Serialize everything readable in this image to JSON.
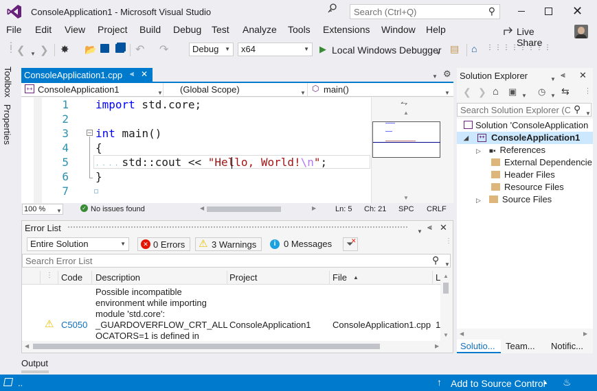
{
  "titlebar": {
    "title": "ConsoleApplication1 - Microsoft Visual Studio",
    "search_placeholder": "Search (Ctrl+Q)"
  },
  "menu": [
    "File",
    "Edit",
    "View",
    "Project",
    "Build",
    "Debug",
    "Test",
    "Analyze",
    "Tools",
    "Extensions",
    "Window",
    "Help"
  ],
  "live_share": "Live Share",
  "toolbar": {
    "config": "Debug",
    "platform": "x64",
    "run_label": "Local Windows Debugger"
  },
  "side_tabs": [
    "Toolbox",
    "Properties"
  ],
  "editor": {
    "tab_label": "ConsoleApplication1.cpp",
    "nav_project": "ConsoleApplication1",
    "nav_scope": "(Global Scope)",
    "nav_member": "main()",
    "line_numbers": [
      "1",
      "2",
      "3",
      "4",
      "5",
      "6",
      "7"
    ],
    "code": {
      "l1_kw": "import",
      "l1_rest": " std.core;",
      "l3_kw": "int",
      "l3_rest": " main()",
      "l4": "{",
      "l5_pre": "    std::cout << ",
      "l5_str": "\"Hello, World!",
      "l5_esc": "\\n",
      "l5_end_str": "\"",
      "l5_end": ";",
      "l6": "}"
    },
    "status": {
      "zoom": "100 %",
      "issues": "No issues found",
      "ln": "Ln: 5",
      "ch": "Ch: 21",
      "spc": "SPC",
      "crlf": "CRLF"
    }
  },
  "error_list": {
    "title": "Error List",
    "scope": "Entire Solution",
    "errors": "0 Errors",
    "warnings": "3 Warnings",
    "messages": "0 Messages",
    "search_placeholder": "Search Error List",
    "columns": [
      "Code",
      "Description",
      "Project",
      "File",
      "L"
    ],
    "rows": [
      {
        "code": "C5050",
        "description": "Possible incompatible environment while importing module 'std.core': _GUARDOVERFLOW_CRT_ALLOCATORS=1 is defined in",
        "desc_lines": [
          "Possible incompatible",
          "environment while importing",
          "module 'std.core':",
          "_GUARDOVERFLOW_CRT_ALL",
          "OCATORS=1 is defined in"
        ],
        "project": "ConsoleApplication1",
        "file": "ConsoleApplication1.cpp",
        "line": "1"
      }
    ]
  },
  "output_tab": "Output",
  "solution_explorer": {
    "title": "Solution Explorer",
    "search_placeholder": "Search Solution Explorer (C",
    "solution": "Solution 'ConsoleApplication",
    "project": "ConsoleApplication1",
    "items": [
      "References",
      "External Dependencie",
      "Header Files",
      "Resource Files",
      "Source Files"
    ],
    "bottom_tabs": [
      "Solutio...",
      "Team...",
      "Notific..."
    ]
  },
  "statusbar": {
    "left": "..",
    "source_control": "Add to Source Control"
  },
  "colors": {
    "accent": "#007acc",
    "tab_active": "#007acc",
    "warning": "#e8c000",
    "error": "#e51400"
  }
}
